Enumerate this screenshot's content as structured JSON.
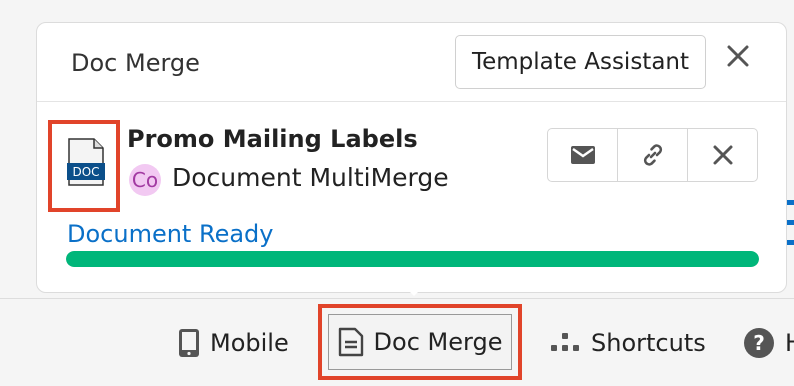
{
  "panel": {
    "title": "Doc Merge",
    "template_button_label": "Template Assistant",
    "close_icon": "close-icon"
  },
  "job": {
    "file_badge": "DOC",
    "title": "Promo Mailing Labels",
    "avatar_initials": "Co",
    "subtitle": "Document MultiMerge",
    "actions": [
      "email-icon",
      "link-icon",
      "remove-icon"
    ],
    "status": "Document Ready",
    "progress": 1.0,
    "progress_color": "#00b67a",
    "status_color": "#0a70c8"
  },
  "footer": {
    "items": [
      {
        "label": "Mobile",
        "icon": "mobile-icon"
      },
      {
        "label": "Doc Merge",
        "icon": "document-icon"
      },
      {
        "label": "Shortcuts",
        "icon": "shortcuts-icon"
      },
      {
        "label": "H",
        "icon": "help-icon"
      }
    ]
  },
  "colors": {
    "highlight": "#e1442a",
    "avatar_bg": "#f2c9f2"
  }
}
